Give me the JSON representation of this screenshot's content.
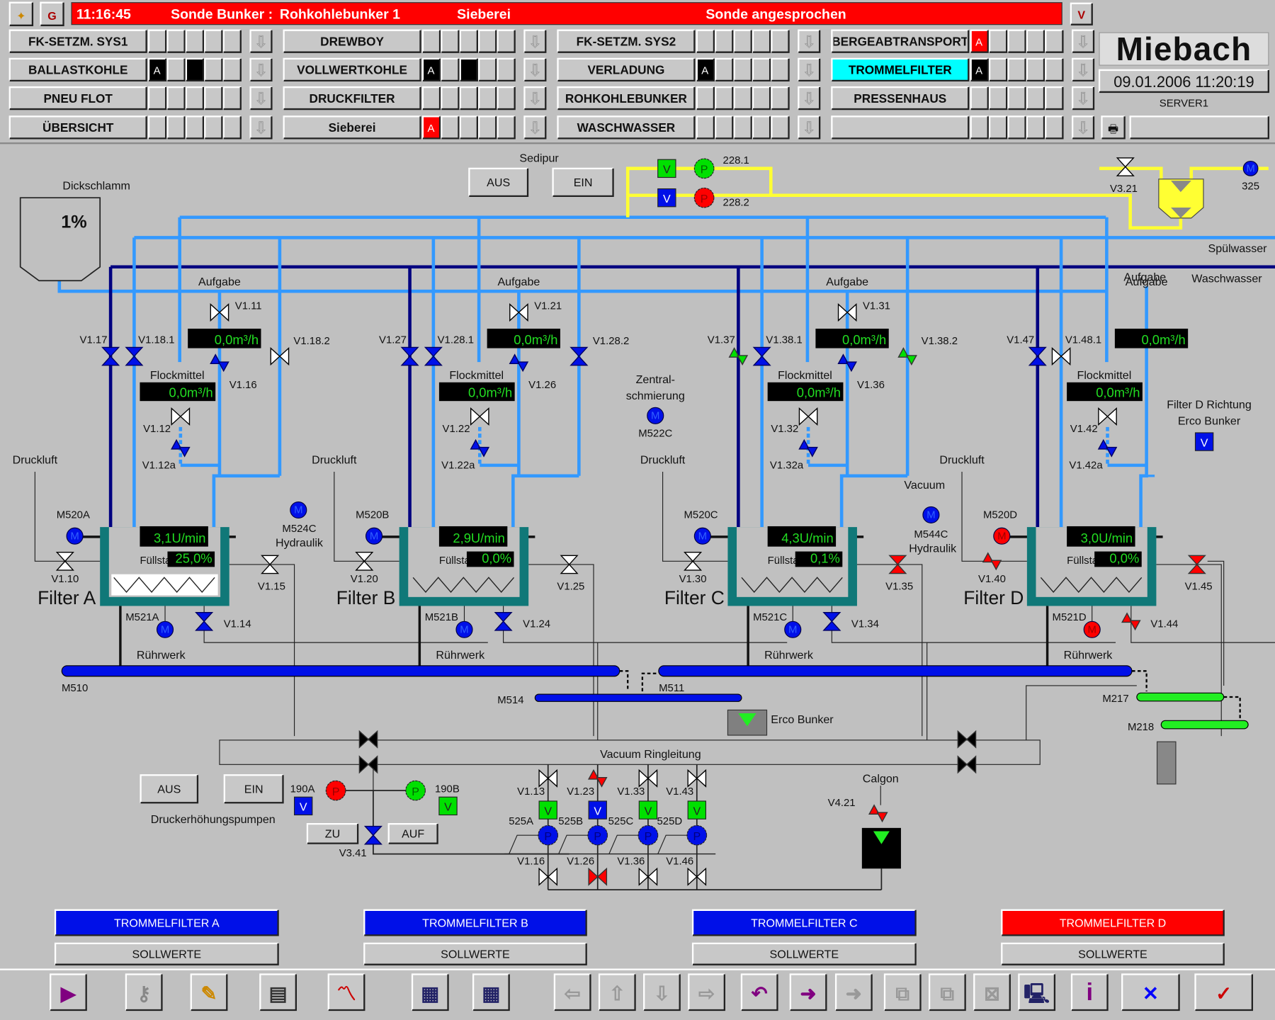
{
  "header": {
    "time": "11:16:45",
    "alarm_fields": [
      "Sonde Bunker :",
      "Rohkohlebunker 1",
      "Sieberei",
      "Sonde angesprochen"
    ],
    "left_icons": [
      "new-alarm-icon",
      "exit-icon"
    ],
    "right_icon": "acknowledge-icon"
  },
  "nav": [
    [
      {
        "label": "FK-SETZM. SYS1",
        "slots": [
          "",
          "",
          "",
          "",
          ""
        ]
      },
      {
        "label": "BALLASTKOHLE",
        "slots": [
          "A",
          "",
          "fill",
          "",
          ""
        ]
      },
      {
        "label": "PNEU FLOT",
        "slots": [
          "",
          "",
          "",
          "",
          ""
        ]
      },
      {
        "label": "ÜBERSICHT",
        "slots": [
          "",
          "",
          "",
          "",
          ""
        ]
      }
    ],
    [
      {
        "label": "DREWBOY",
        "slots": [
          "",
          "",
          "",
          "",
          ""
        ]
      },
      {
        "label": "VOLLWERTKOHLE",
        "slots": [
          "A",
          "",
          "fill",
          "",
          ""
        ]
      },
      {
        "label": "DRUCKFILTER",
        "slots": [
          "",
          "",
          "",
          "",
          ""
        ]
      },
      {
        "label": "Sieberei",
        "slots": [
          "A-red",
          "",
          "",
          "",
          ""
        ]
      }
    ],
    [
      {
        "label": "FK-SETZM. SYS2",
        "slots": [
          "",
          "",
          "",
          "",
          ""
        ]
      },
      {
        "label": "VERLADUNG",
        "slots": [
          "A",
          "",
          "",
          "",
          ""
        ]
      },
      {
        "label": "ROHKOHLEBUNKER",
        "slots": [
          "",
          "",
          "",
          "",
          ""
        ]
      },
      {
        "label": "WASCHWASSER",
        "slots": [
          "",
          "",
          "",
          "",
          ""
        ]
      }
    ],
    [
      {
        "label": "BERGEABTRANSPORT",
        "slots": [
          "A-red",
          "",
          "",
          "",
          ""
        ]
      },
      {
        "label": "TROMMELFILTER",
        "slots": [
          "A",
          "",
          "",
          "",
          ""
        ],
        "active": true
      },
      {
        "label": "PRESSENHAUS",
        "slots": [
          "",
          "",
          "",
          "",
          ""
        ]
      },
      {
        "label": "",
        "slots": [
          "",
          "",
          "",
          "",
          ""
        ]
      }
    ]
  ],
  "slot_letter": "A",
  "brand": {
    "logo": "Miebach",
    "datetime": "09.01.2006 11:20:19",
    "server": "SERVER1"
  },
  "colors": {
    "background": "#c0c0c0",
    "alarm": "#ff0000",
    "active_nav": "#00ffff",
    "blue": "#0010e8",
    "white": "#ffffff",
    "red": "#ff0000",
    "green": "#00e000",
    "black": "#000000",
    "pipe_light": "#3399ff",
    "pipe_dark": "#000080",
    "pipe_yellow": "#ffff33",
    "tank": "#107878",
    "display_text": "#22dd22"
  },
  "plant": {
    "dickschlamm": {
      "label": "Dickschlamm",
      "value": "1%"
    },
    "sedipur": {
      "label": "Sedipur",
      "aus": "AUS",
      "ein": "EIN"
    },
    "dosing": [
      {
        "label": "228.1",
        "valve": "V",
        "valve_state": "green",
        "pump": "P",
        "pump_state": "green"
      },
      {
        "label": "228.2",
        "valve": "V",
        "valve_state": "blue",
        "pump": "P",
        "pump_state": "red"
      }
    ],
    "v321": "V3.21",
    "m325": {
      "label": "325",
      "icon": "M"
    },
    "spuelwasser": "Spülwasser",
    "waschwasser": "Waschwasser",
    "zentral": [
      "Zentral-",
      "schmierung"
    ],
    "m522c": "M522C",
    "m524c": [
      "M524C",
      "Hydraulik"
    ],
    "m544c": [
      "M544C",
      "Hydraulik"
    ],
    "vacuum": "Vacuum",
    "filter_d_note": [
      "Filter D Richtung",
      "Erco Bunker"
    ],
    "filter_d_valve": "V",
    "motor_letter": "M",
    "bus": {
      "m510": "M510",
      "m511": "M511",
      "m514": "M514",
      "m217": "M217",
      "m218": "M218"
    },
    "erco": "Erco Bunker",
    "ring": "Vacuum Ringleitung",
    "boost": {
      "aus": "AUS",
      "ein": "EIN",
      "label": "Druckerhöhungspumpen",
      "a": {
        "label": "190A",
        "valve": "V",
        "valve_state": "blue",
        "pump": "P",
        "pump_state": "red"
      },
      "b": {
        "label": "190B",
        "valve": "V",
        "valve_state": "green",
        "pump": "P",
        "pump_state": "green"
      },
      "zu": "ZU",
      "auf": "AUF",
      "v341": "V3.41"
    },
    "vac_pumps": [
      {
        "pump": "525A",
        "top": "V1.13",
        "top_state": "white",
        "top_symbol": "bowtie",
        "v": "V",
        "v_state": "green",
        "bottom": "V1.16",
        "bottom_state": "white"
      },
      {
        "pump": "525B",
        "top": "V1.23",
        "top_state": "red",
        "top_symbol": "control",
        "v": "V",
        "v_state": "blue",
        "bottom": "V1.26",
        "bottom_state": "red"
      },
      {
        "pump": "525C",
        "top": "V1.33",
        "top_state": "white",
        "top_symbol": "bowtie",
        "v": "V",
        "v_state": "green",
        "bottom": "V1.36",
        "bottom_state": "white"
      },
      {
        "pump": "525D",
        "top": "V1.43",
        "top_state": "white",
        "top_symbol": "bowtie",
        "v": "V",
        "v_state": "green",
        "bottom": "V1.46",
        "bottom_state": "white"
      }
    ],
    "pump_letter": "P",
    "calgon": {
      "label": "Calgon",
      "valve": "V4.21",
      "valve_state": "red"
    }
  },
  "filters": [
    {
      "name": "Filter A",
      "aufgabe": "Aufgabe",
      "flockmittel": "Flockmittel",
      "druckluft": "Druckluft",
      "fuellstand": "Füllstand",
      "ruehrwerk": "Rührwerk",
      "motor_drive": "M520A",
      "motor_drive_state": "blue",
      "motor_stir": "M521A",
      "motor_stir_state": "blue",
      "flow": "0,0m³/h",
      "flock_flow": "0,0m³/h",
      "speed": "3,1U/min",
      "level": "25,0%",
      "level_pct": 25,
      "valves": {
        "wash": {
          "label": "V1.17",
          "state": "blue",
          "symbol": "hourglass"
        },
        "rinse": {
          "label": "V1.18.1",
          "state": "blue",
          "symbol": "hourglass"
        },
        "feed": {
          "label": "V1.11",
          "state": "white",
          "symbol": "bowtie"
        },
        "rinse2": {
          "label": "V1.18.2",
          "state": "white",
          "symbol": "bowtie"
        },
        "feed_ctrl": {
          "label": "V1.16",
          "state": "blue",
          "symbol": "control"
        },
        "flock": {
          "label": "V1.12",
          "state": "white",
          "symbol": "bowtie"
        },
        "flock_ctrl": {
          "label": "V1.12a",
          "state": "blue",
          "symbol": "control"
        },
        "air": {
          "label": "V1.10",
          "state": "white",
          "symbol": "hourglass"
        },
        "drain": {
          "label": "V1.15",
          "state": "white",
          "symbol": "hourglass"
        },
        "bottom": {
          "label": "V1.14",
          "state": "blue",
          "symbol": "hourglass"
        }
      }
    },
    {
      "name": "Filter B",
      "aufgabe": "Aufgabe",
      "flockmittel": "Flockmittel",
      "druckluft": "Druckluft",
      "fuellstand": "Füllstand",
      "ruehrwerk": "Rührwerk",
      "motor_drive": "M520B",
      "motor_drive_state": "blue",
      "motor_stir": "M521B",
      "motor_stir_state": "blue",
      "flow": "0,0m³/h",
      "flock_flow": "0,0m³/h",
      "speed": "2,9U/min",
      "level": "0,0%",
      "level_pct": 0,
      "valves": {
        "wash": {
          "label": "V1.27",
          "state": "blue",
          "symbol": "hourglass"
        },
        "rinse": {
          "label": "V1.28.1",
          "state": "blue",
          "symbol": "hourglass"
        },
        "feed": {
          "label": "V1.21",
          "state": "white",
          "symbol": "bowtie"
        },
        "rinse2": {
          "label": "V1.28.2",
          "state": "blue",
          "symbol": "hourglass"
        },
        "feed_ctrl": {
          "label": "V1.26",
          "state": "blue",
          "symbol": "control"
        },
        "flock": {
          "label": "V1.22",
          "state": "white",
          "symbol": "bowtie"
        },
        "flock_ctrl": {
          "label": "V1.22a",
          "state": "blue",
          "symbol": "control"
        },
        "air": {
          "label": "V1.20",
          "state": "white",
          "symbol": "hourglass"
        },
        "drain": {
          "label": "V1.25",
          "state": "white",
          "symbol": "hourglass"
        },
        "bottom": {
          "label": "V1.24",
          "state": "blue",
          "symbol": "hourglass"
        }
      }
    },
    {
      "name": "Filter C",
      "aufgabe": "Aufgabe",
      "flockmittel": "Flockmittel",
      "druckluft": "Druckluft",
      "fuellstand": "Füllstand",
      "ruehrwerk": "Rührwerk",
      "motor_drive": "M520C",
      "motor_drive_state": "blue",
      "motor_stir": "M521C",
      "motor_stir_state": "blue",
      "flow": "0,0m³/h",
      "flock_flow": "0,0m³/h",
      "speed": "4,3U/min",
      "level": "0,1%",
      "level_pct": 0.1,
      "valves": {
        "wash": {
          "label": "V1.37",
          "state": "green",
          "symbol": "control"
        },
        "rinse": {
          "label": "V1.38.1",
          "state": "blue",
          "symbol": "hourglass"
        },
        "feed": {
          "label": "V1.31",
          "state": "white",
          "symbol": "bowtie"
        },
        "rinse2": {
          "label": "V1.38.2",
          "state": "green",
          "symbol": "control"
        },
        "feed_ctrl": {
          "label": "V1.36",
          "state": "blue",
          "symbol": "control"
        },
        "flock": {
          "label": "V1.32",
          "state": "white",
          "symbol": "bowtie"
        },
        "flock_ctrl": {
          "label": "V1.32a",
          "state": "blue",
          "symbol": "control"
        },
        "air": {
          "label": "V1.30",
          "state": "white",
          "symbol": "hourglass"
        },
        "drain": {
          "label": "V1.35",
          "state": "red",
          "symbol": "hourglass"
        },
        "bottom": {
          "label": "V1.34",
          "state": "blue",
          "symbol": "hourglass"
        }
      }
    },
    {
      "name": "Filter D",
      "aufgabe": "Aufgabe",
      "flockmittel": "Flockmittel",
      "druckluft": "Druckluft",
      "fuellstand": "Füllstand",
      "ruehrwerk": "Rührwerk",
      "motor_drive": "M520D",
      "motor_drive_state": "red",
      "motor_stir": "M521D",
      "motor_stir_state": "red",
      "flow": "0,0m³/h",
      "flock_flow": "0,0m³/h",
      "speed": "3,0U/min",
      "level": "0,0%",
      "level_pct": 0,
      "valves": {
        "wash": {
          "label": "V1.47",
          "state": "blue",
          "symbol": "hourglass"
        },
        "rinse": {
          "label": "V1.48.1",
          "state": "white",
          "symbol": "bowtie"
        },
        "flock": {
          "label": "V1.42",
          "state": "white",
          "symbol": "bowtie"
        },
        "flock_ctrl": {
          "label": "V1.42a",
          "state": "blue",
          "symbol": "control"
        },
        "air": {
          "label": "V1.40",
          "state": "red",
          "symbol": "control"
        },
        "drain": {
          "label": "V1.45",
          "state": "red",
          "symbol": "hourglass"
        },
        "bottom": {
          "label": "V1.44",
          "state": "red",
          "symbol": "control"
        }
      }
    }
  ],
  "filter_buttons": [
    {
      "label": "TROMMELFILTER A",
      "state": "blue",
      "sollwerte": "SOLLWERTE"
    },
    {
      "label": "TROMMELFILTER B",
      "state": "blue",
      "sollwerte": "SOLLWERTE"
    },
    {
      "label": "TROMMELFILTER C",
      "state": "blue",
      "sollwerte": "SOLLWERTE"
    },
    {
      "label": "TROMMELFILTER D",
      "state": "red",
      "sollwerte": "SOLLWERTE"
    }
  ],
  "toolbar": [
    "play-icon",
    "key-icon",
    "new-document-icon",
    "print-list-icon",
    "trend-icon",
    "report-t-icon",
    "report-p-icon",
    "arrow-left-icon",
    "arrow-up-icon",
    "arrow-down-icon",
    "arrow-right-icon",
    "undo-icon",
    "jump-icon",
    "next-icon",
    "window-up-icon",
    "window-down-icon",
    "window-close-icon",
    "network-search-icon",
    "info-icon",
    "alarm-mute-icon",
    "alarm-acknowledge-icon"
  ]
}
